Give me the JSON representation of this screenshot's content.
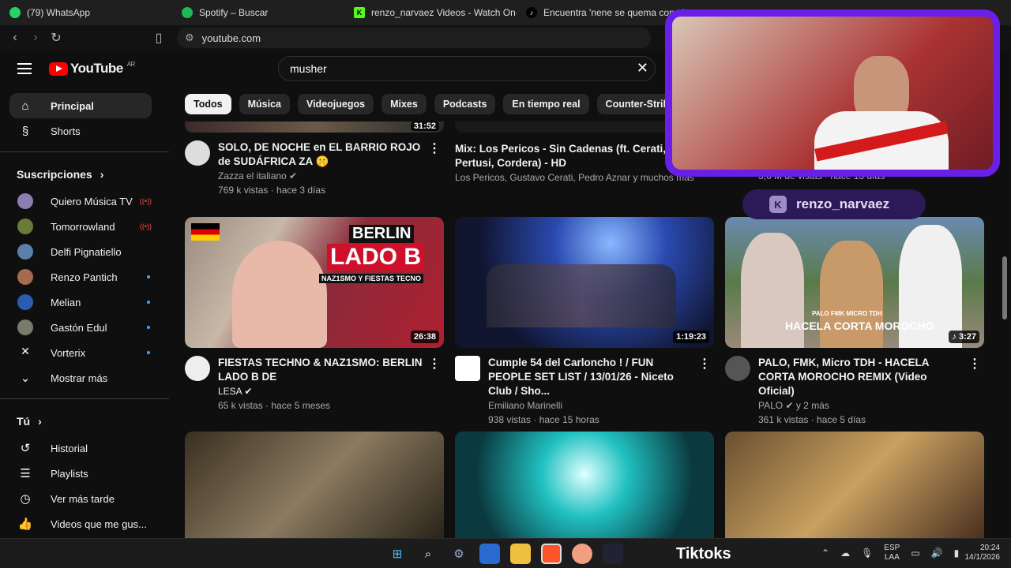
{
  "browser": {
    "tabs": [
      {
        "title": "(79) WhatsApp",
        "color": "#25d366",
        "glyph": "✆"
      },
      {
        "title": "Spotify – Buscar",
        "color": "#1db954",
        "glyph": "≋"
      },
      {
        "title": "renzo_narvaez Videos - Watch On-De",
        "color": "#53fc18",
        "glyph": "K"
      },
      {
        "title": "Encuentra 'nene se quema con el m",
        "color": "#ffffff",
        "glyph": "♪"
      }
    ],
    "url": "youtube.com"
  },
  "youtube": {
    "logo_text": "YouTube",
    "region": "AR",
    "search_query": "musher",
    "sidebar": {
      "main": [
        {
          "label": "Principal",
          "icon": "home-icon",
          "glyph": "⌂"
        },
        {
          "label": "Shorts",
          "icon": "shorts-icon",
          "glyph": "§"
        }
      ],
      "subscriptions_title": "Suscripciones",
      "subscriptions": [
        {
          "label": "Quiero Música TV",
          "color": "#8a7fb0",
          "badge": "live"
        },
        {
          "label": "Tomorrowland",
          "color": "#6a7a3a",
          "badge": "live"
        },
        {
          "label": "Delfi Pignatiello",
          "color": "#5a7fa8",
          "badge": ""
        },
        {
          "label": "Renzo Pantich",
          "color": "#a86a4f",
          "badge": "new"
        },
        {
          "label": "Melian",
          "color": "#2a5db0",
          "badge": "new"
        },
        {
          "label": "Gastón Edul",
          "color": "#7a7a6a",
          "badge": "new"
        },
        {
          "label": "Vorterix",
          "color": "#ffffff",
          "badge": "new"
        }
      ],
      "show_more": "Mostrar más",
      "you_title": "Tú",
      "you": [
        {
          "label": "Historial",
          "icon": "history-icon",
          "glyph": "↺"
        },
        {
          "label": "Playlists",
          "icon": "playlists-icon",
          "glyph": "☰"
        },
        {
          "label": "Ver más tarde",
          "icon": "watch-later-icon",
          "glyph": "◷"
        },
        {
          "label": "Videos que me gus...",
          "icon": "liked-videos-icon",
          "glyph": "👍"
        }
      ]
    },
    "chips": [
      "Todos",
      "Música",
      "Videojuegos",
      "Mixes",
      "Podcasts",
      "En tiempo real",
      "Counter-Strike"
    ],
    "top_row": [
      {
        "title": "SOLO, DE NOCHE en EL BARRIO ROJO de SUDÁFRICA ZA 🤫",
        "channel": "Zazza el italiano ✔",
        "stats": "769 k vistas · hace 3 días",
        "duration": "31:52"
      },
      {
        "title": "Mix: Los Pericos - Sin Cadenas (ft. Cerati, Pertusi, Cordera) - HD",
        "channel": "Los Pericos, Gustavo Cerati, Pedro Aznar y muchos más",
        "stats": "",
        "duration": ""
      },
      {
        "title": "",
        "channel": "",
        "stats": "3,6 M de vistas · hace 13 días",
        "duration": ""
      }
    ],
    "mid_row": [
      {
        "title": "FIESTAS TECHNO & NAZ1SMO: BERLIN LADO B DE",
        "channel": "LESA ✔",
        "stats": "65 k vistas · hace 5 meses",
        "duration": "26:38",
        "thumb_text": "LADO B",
        "thumb_top": "BERLIN",
        "thumb_sub": "NAZ1SMO Y FIESTAS TECNO"
      },
      {
        "title": "Cumple 54 del Carloncho ! / FUN PEOPLE SET LIST / 13/01/26 - Niceto Club / Sho...",
        "channel": "Emiliano Marinelli",
        "stats": "938 vistas · hace 15 horas",
        "duration": "1:19:23"
      },
      {
        "title": "PALO, FMK, Micro TDH - HACELA CORTA MOROCHO REMIX (Video Oficial)",
        "channel": "PALO ✔ y 2 más",
        "stats": "361 k vistas · hace 5 días",
        "duration": "3:27",
        "thumb_text": "HACELA CORTA MOROCHO",
        "thumb_sub": "PALO FMK MICRO TDH"
      }
    ]
  },
  "stream_overlay": {
    "streamer": "renzo_narvaez",
    "platform_glyph": "K"
  },
  "taskbar": {
    "label": "Tiktoks",
    "lang_top": "ESP",
    "lang_bottom": "LAA",
    "time": "20:24",
    "date": "14/1/2026"
  }
}
